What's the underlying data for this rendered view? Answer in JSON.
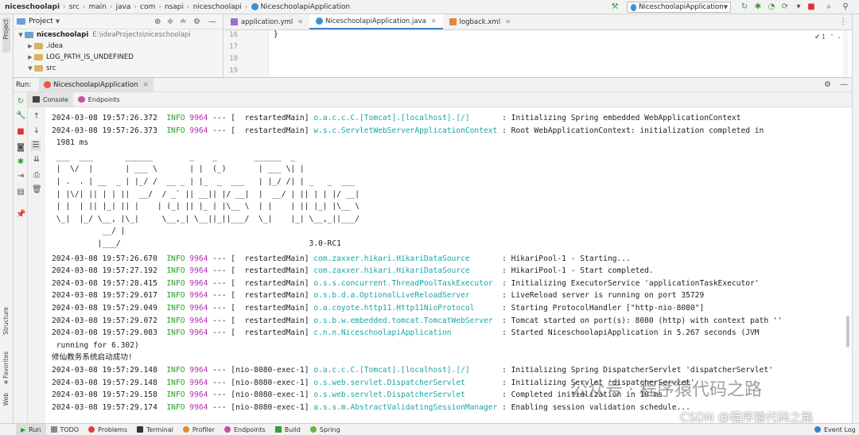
{
  "breadcrumb": [
    "niceschoolapi",
    "src",
    "main",
    "java",
    "com",
    "nsapi",
    "niceschoolapi",
    "NiceschoolapiApplication"
  ],
  "run_config": "NiceschoolapiApplication",
  "project": {
    "header": "Project",
    "tree": [
      {
        "label": "niceschoolapi",
        "path": "E:\\ideaProjects\\niceschoolapi",
        "expanded": true
      },
      {
        "label": ".idea"
      },
      {
        "label": "LOG_PATH_IS_UNDEFINED"
      },
      {
        "label": "src",
        "expanded": true
      }
    ]
  },
  "editor": {
    "tabs": [
      {
        "label": "application.yml"
      },
      {
        "label": "NiceschoolapiApplication.java",
        "active": true
      },
      {
        "label": "logback.xml"
      }
    ],
    "lines": [
      {
        "no": "16",
        "code": "}"
      },
      {
        "no": "17",
        "code": ""
      },
      {
        "no": "18",
        "code": ""
      },
      {
        "no": "19",
        "code": ""
      }
    ],
    "inspection": "1"
  },
  "run_panel": {
    "label": "Run:",
    "tab": "NiceschoolapiApplication",
    "subtabs": [
      "Console",
      "Endpoints"
    ]
  },
  "console": {
    "log_lines": [
      {
        "ts": "2024-03-08 19:57:26.372",
        "level": "INFO",
        "pid": "9964",
        "sep": "---",
        "thread": "[  restartedMain]",
        "logger": "o.a.c.c.C.[Tomcat].[localhost].[/]      ",
        "msg": ": Initializing Spring embedded WebApplicationContext"
      },
      {
        "ts": "2024-03-08 19:57:26.373",
        "level": "INFO",
        "pid": "9964",
        "sep": "---",
        "thread": "[  restartedMain]",
        "logger": "w.s.c.ServletWebServerApplicationContext",
        "msg": ": Root WebApplicationContext: initialization completed in"
      },
      {
        "ts": "2024-03-08 19:57:26.670",
        "level": "INFO",
        "pid": "9964",
        "sep": "---",
        "thread": "[  restartedMain]",
        "logger": "com.zaxxer.hikari.HikariDataSource      ",
        "msg": ": HikariPool-1 - Starting..."
      },
      {
        "ts": "2024-03-08 19:57:27.192",
        "level": "INFO",
        "pid": "9964",
        "sep": "---",
        "thread": "[  restartedMain]",
        "logger": "com.zaxxer.hikari.HikariDataSource      ",
        "msg": ": HikariPool-1 - Start completed."
      },
      {
        "ts": "2024-03-08 19:57:28.415",
        "level": "INFO",
        "pid": "9964",
        "sep": "---",
        "thread": "[  restartedMain]",
        "logger": "o.s.s.concurrent.ThreadPoolTaskExecutor ",
        "msg": ": Initializing ExecutorService 'applicationTaskExecutor'"
      },
      {
        "ts": "2024-03-08 19:57:29.017",
        "level": "INFO",
        "pid": "9964",
        "sep": "---",
        "thread": "[  restartedMain]",
        "logger": "o.s.b.d.a.OptionalLiveReloadServer      ",
        "msg": ": LiveReload server is running on port 35729"
      },
      {
        "ts": "2024-03-08 19:57:29.049",
        "level": "INFO",
        "pid": "9964",
        "sep": "---",
        "thread": "[  restartedMain]",
        "logger": "o.a.coyote.http11.Http11NioProtocol     ",
        "msg": ": Starting ProtocolHandler [\"http-nio-8080\"]"
      },
      {
        "ts": "2024-03-08 19:57:29.072",
        "level": "INFO",
        "pid": "9964",
        "sep": "---",
        "thread": "[  restartedMain]",
        "logger": "o.s.b.w.embedded.tomcat.TomcatWebServer ",
        "msg": ": Tomcat started on port(s): 8080 (http) with context path ''"
      },
      {
        "ts": "2024-03-08 19:57:29.083",
        "level": "INFO",
        "pid": "9964",
        "sep": "---",
        "thread": "[  restartedMain]",
        "logger": "c.n.n.NiceschoolapiApplication          ",
        "msg": ": Started NiceschoolapiApplication in 5.267 seconds (JVM"
      },
      {
        "ts": "2024-03-08 19:57:29.148",
        "level": "INFO",
        "pid": "9964",
        "sep": "---",
        "thread": "[nio-8080-exec-1]",
        "logger": "o.a.c.c.C.[Tomcat].[localhost].[/]      ",
        "msg": ": Initializing Spring DispatcherServlet 'dispatcherServlet'"
      },
      {
        "ts": "2024-03-08 19:57:29.148",
        "level": "INFO",
        "pid": "9964",
        "sep": "---",
        "thread": "[nio-8080-exec-1]",
        "logger": "o.s.web.servlet.DispatcherServlet       ",
        "msg": ": Initializing Servlet 'dispatcherServlet'"
      },
      {
        "ts": "2024-03-08 19:57:29.158",
        "level": "INFO",
        "pid": "9964",
        "sep": "---",
        "thread": "[nio-8080-exec-1]",
        "logger": "o.s.web.servlet.DispatcherServlet       ",
        "msg": ": Completed initialization in 10 ms"
      },
      {
        "ts": "2024-03-08 19:57:29.174",
        "level": "INFO",
        "pid": "9964",
        "sep": "---",
        "thread": "[nio-8080-exec-1]",
        "logger": "a.s.s.m.AbstractValidatingSessionManager",
        "msg": ": Enabling session validation schedule..."
      }
    ],
    "wrap_1981": " 1981 ms",
    "wrap_running": " running for 6.302)",
    "chinese_line": "修仙教务系统启动成功!",
    "banner": [
      " ___  ___       ______        _    _        ______  _",
      " |  \\/  |       | ___ \\       | |  (_)       | ___ \\| |",
      " | .  . | __  _ | |_/ /  __ _ | |_  _  ___   | |_/ /| | _   _  ___",
      " | |\\/| || | | ||  __/  / _` || __|| |/ __|  |  __/ | || | | |/ __|",
      " | |  | || |_| || |    | (_| || |_ | |\\__ \\  | |    | || |_| |\\__ \\",
      " \\_|  |_/ \\__, |\\_|     \\__,_| \\__||_||___/  \\_|    |_| \\__,_||___/",
      "           __/ |",
      "          |___/                                         3.0-RC1"
    ]
  },
  "bottom_tabs": [
    "Run",
    "TODO",
    "Problems",
    "Terminal",
    "Profiler",
    "Endpoints",
    "Build",
    "Spring"
  ],
  "event_log": "Event Log",
  "left_strip": {
    "project": "Project",
    "structure": "Structure",
    "favorites": "Favorites",
    "web": "Web"
  },
  "watermark": {
    "line1": "公众号 · 程序猿代码之路",
    "line2": "CSDN @程序猿代码之路"
  },
  "colors": {
    "info": "#2aa02a",
    "pid": "#b030b0",
    "logger": "#1ba5a5",
    "accent": "#4083c9"
  }
}
